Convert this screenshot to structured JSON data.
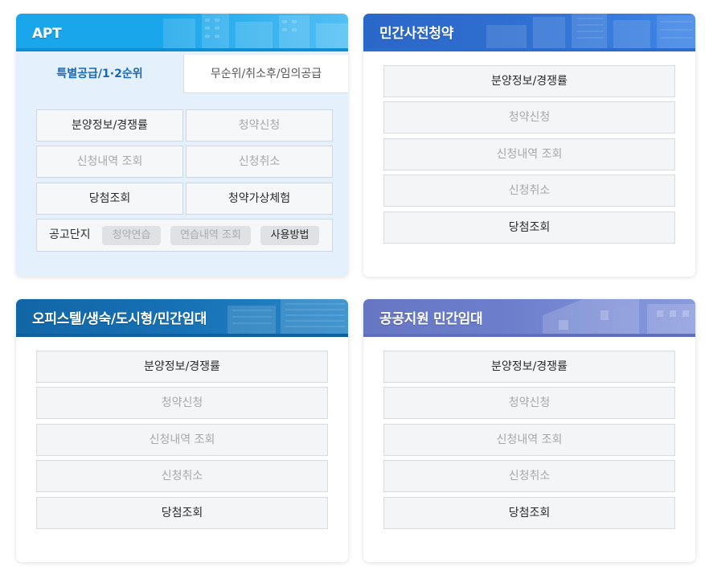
{
  "apt": {
    "title": "APT",
    "tabs": [
      "특별공급/1·2순위",
      "무순위/취소후/임의공급"
    ],
    "buttons": [
      {
        "label": "분양정보/경쟁률",
        "enabled": true
      },
      {
        "label": "청약신청",
        "enabled": false
      },
      {
        "label": "신청내역 조회",
        "enabled": false
      },
      {
        "label": "신청취소",
        "enabled": false
      },
      {
        "label": "당첨조회",
        "enabled": true
      },
      {
        "label": "청약가상체험",
        "enabled": true
      }
    ],
    "notice": {
      "label": "공고단지",
      "pills": [
        {
          "label": "청약연습",
          "enabled": false
        },
        {
          "label": "연습내역 조회",
          "enabled": false
        },
        {
          "label": "사용방법",
          "enabled": true
        }
      ]
    }
  },
  "pre_sale": {
    "title": "민간사전청약",
    "buttons": [
      {
        "label": "분양정보/경쟁률",
        "enabled": true
      },
      {
        "label": "청약신청",
        "enabled": false
      },
      {
        "label": "신청내역 조회",
        "enabled": false
      },
      {
        "label": "신청취소",
        "enabled": false
      },
      {
        "label": "당첨조회",
        "enabled": true
      }
    ]
  },
  "officetel": {
    "title": "오피스텔/생숙/도시형/민간임대",
    "buttons": [
      {
        "label": "분양정보/경쟁률",
        "enabled": true
      },
      {
        "label": "청약신청",
        "enabled": false
      },
      {
        "label": "신청내역 조회",
        "enabled": false
      },
      {
        "label": "신청취소",
        "enabled": false
      },
      {
        "label": "당첨조회",
        "enabled": true
      }
    ]
  },
  "public_rental": {
    "title": "공공지원 민간임대",
    "buttons": [
      {
        "label": "분양정보/경쟁률",
        "enabled": true
      },
      {
        "label": "청약신청",
        "enabled": false
      },
      {
        "label": "신청내역 조회",
        "enabled": false
      },
      {
        "label": "신청취소",
        "enabled": false
      },
      {
        "label": "당첨조회",
        "enabled": true
      }
    ]
  },
  "colors": {
    "apt_header": "#1aa6ea",
    "apt_panel": "#e4f1fc",
    "active_tab_text": "#1968b6",
    "pre_sale_header": "#2f6fd0",
    "officetel_header": "#1670b3",
    "public_rental_header": "#6d7fcc",
    "disabled_text": "#a5a7aa"
  }
}
